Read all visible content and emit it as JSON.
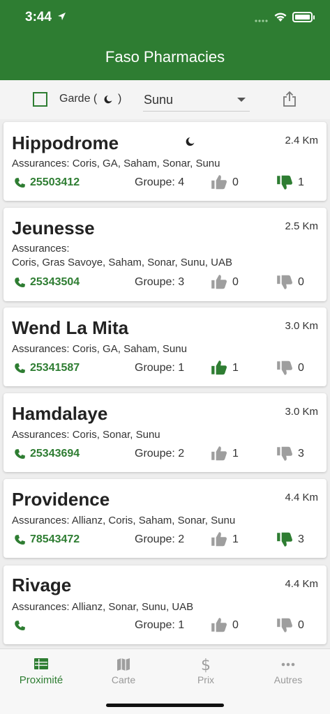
{
  "status_bar": {
    "time": "3:44"
  },
  "header": {
    "title": "Faso Pharmacies"
  },
  "filter": {
    "garde_label": "Garde (",
    "garde_close": ")",
    "garde_checked": false,
    "insurance_selected": "Sunu"
  },
  "colors": {
    "primary": "#2e7d32",
    "inactive_icon": "#9e9e9e"
  },
  "pharmacies": [
    {
      "name": "Hippodrome",
      "distance": "2.4 Km",
      "garde": true,
      "insurance_label": "Assurances:",
      "insurances": "Coris, GA, Saham, Sonar, Sunu",
      "phone": "25503412",
      "group": "Groupe: 4",
      "likes": "0",
      "dislikes": "1",
      "liked": false,
      "disliked": true
    },
    {
      "name": "Jeunesse",
      "distance": "2.5 Km",
      "garde": false,
      "insurance_label": "Assurances:",
      "insurances": "Coris, Gras Savoye, Saham, Sonar, Sunu, UAB",
      "phone": "25343504",
      "group": "Groupe: 3",
      "likes": "0",
      "dislikes": "0",
      "liked": false,
      "disliked": false
    },
    {
      "name": "Wend La Mita",
      "distance": "3.0 Km",
      "garde": false,
      "insurance_label": "Assurances:",
      "insurances": "Coris, GA, Saham, Sunu",
      "phone": "25341587",
      "group": "Groupe: 1",
      "likes": "1",
      "dislikes": "0",
      "liked": true,
      "disliked": false
    },
    {
      "name": "Hamdalaye",
      "distance": "3.0 Km",
      "garde": false,
      "insurance_label": "Assurances:",
      "insurances": "Coris, Sonar, Sunu",
      "phone": "25343694",
      "group": "Groupe: 2",
      "likes": "1",
      "dislikes": "3",
      "liked": false,
      "disliked": false
    },
    {
      "name": "Providence",
      "distance": "4.4 Km",
      "garde": false,
      "insurance_label": "Assurances:",
      "insurances": "Allianz, Coris, Saham, Sonar, Sunu",
      "phone": "78543472",
      "group": "Groupe: 2",
      "likes": "1",
      "dislikes": "3",
      "liked": false,
      "disliked": true
    },
    {
      "name": "Rivage",
      "distance": "4.4 Km",
      "garde": false,
      "insurance_label": "Assurances:",
      "insurances": "Allianz, Sonar, Sunu, UAB",
      "phone": "",
      "group": "Groupe: 1",
      "likes": "0",
      "dislikes": "0",
      "liked": false,
      "disliked": false
    }
  ],
  "tabs": [
    {
      "label": "Proximité",
      "icon": "list-icon",
      "active": true
    },
    {
      "label": "Carte",
      "icon": "map-icon",
      "active": false
    },
    {
      "label": "Prix",
      "icon": "dollar-icon",
      "active": false
    },
    {
      "label": "Autres",
      "icon": "more-icon",
      "active": false
    }
  ]
}
